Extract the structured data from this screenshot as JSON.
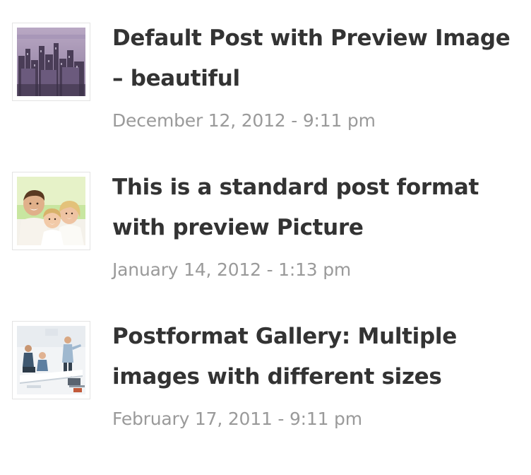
{
  "posts": [
    {
      "title": "Default Post with Preview Image – beautiful",
      "date": "December 12, 2012 - 9:11 pm",
      "thumbnail_icon": "city-skyline-thumbnail"
    },
    {
      "title": "This is a standard post format with preview Picture",
      "date": "January 14, 2012 - 1:13 pm",
      "thumbnail_icon": "family-photo-thumbnail"
    },
    {
      "title": "Postformat Gallery: Multiple images with different sizes",
      "date": "February 17, 2011 - 9:11 pm",
      "thumbnail_icon": "meeting-room-thumbnail"
    }
  ],
  "colors": {
    "title": "#333333",
    "date": "#9a9a9a",
    "thumb_border": "#e3e3e3"
  }
}
